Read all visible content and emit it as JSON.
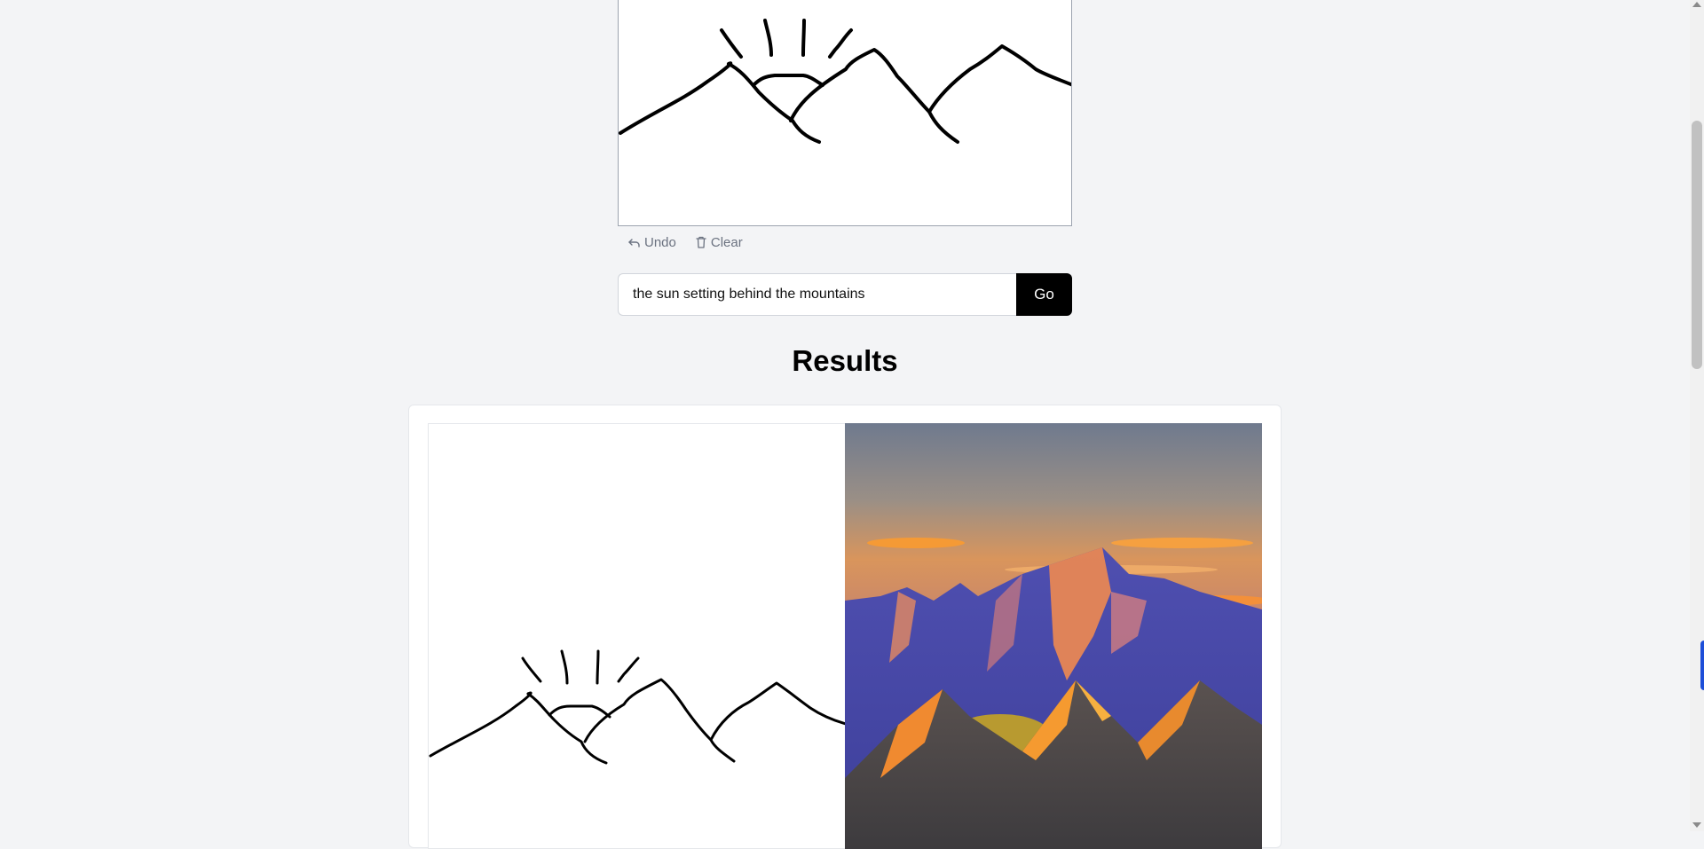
{
  "toolbar": {
    "undo_label": "Undo",
    "clear_label": "Clear"
  },
  "prompt": {
    "value": "the sun setting behind the mountains",
    "go_label": "Go"
  },
  "results": {
    "title": "Results"
  },
  "icons": {
    "undo": "undo-icon",
    "clear": "trash-icon"
  },
  "colors": {
    "background": "#f3f4f6",
    "go_button": "#000000",
    "stroke": "#000000"
  }
}
